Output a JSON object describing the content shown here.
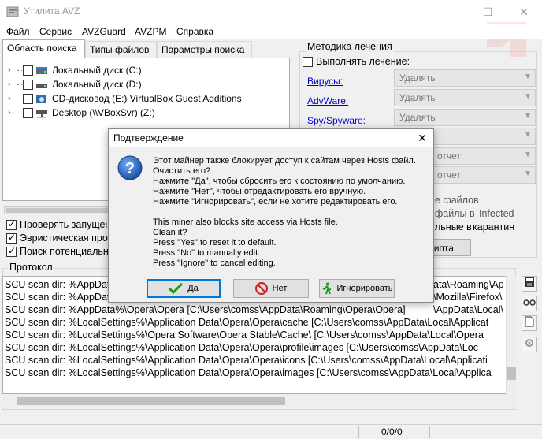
{
  "window": {
    "title": "Утилита AVZ",
    "minimize_glyph": "—",
    "maximize_glyph": "☐",
    "close_glyph": "✕",
    "icon": "avz-app-icon",
    "accent_color": "#e8403a"
  },
  "menu": [
    "Файл",
    "Сервис",
    "AVZGuard",
    "AVZPM",
    "Справка"
  ],
  "tabs": [
    "Область поиска",
    "Типы файлов",
    "Параметры поиска"
  ],
  "tree": {
    "chevron": "›",
    "items": [
      {
        "label": "Локальный диск (C:)",
        "icon": "local-disk-icon"
      },
      {
        "label": "Локальный диск (D:)",
        "icon": "local-disk-icon"
      },
      {
        "label": "CD-дисковод (E:) VirtualBox Guest Additions",
        "icon": "cd-drive-icon"
      },
      {
        "label": "Desktop (\\\\VBoxSvr) (Z:)",
        "icon": "network-drive-icon"
      }
    ]
  },
  "options": [
    {
      "label": "Проверять запущен",
      "checked": true
    },
    {
      "label": "Эвристическая про",
      "checked": true
    },
    {
      "label": "Поиск потенциальн",
      "checked": true
    }
  ],
  "treatment": {
    "group_title": "Методика лечения",
    "enable_label": "Выполнять лечение:",
    "links": [
      "Вирусы:",
      "AdvWare:",
      "Spy/Spyware:"
    ],
    "combos": [
      "Удалять",
      "Удалять",
      "Удалять",
      "",
      "отчет",
      "отчет"
    ],
    "partial_texts": [
      "е файлов",
      "файлы в",
      "Infected",
      "льные в",
      "карантин"
    ],
    "script_button": "рипта"
  },
  "protocol": {
    "title": "Протокол",
    "lines": [
      {
        "left": "SCU scan dir: %AppDat",
        "right": "ata\\Roaming\\Ap"
      },
      {
        "left": "SCU scan dir: %AppDat",
        "right": "\\Mozilla\\Firefox\\"
      },
      {
        "left": "SCU scan dir: %AppData%\\Opera\\Opera [C:\\Users\\comss\\AppData\\Roaming\\Opera\\Opera]",
        "right": "\\AppData\\Local\\"
      },
      {
        "left": "SCU scan dir: %LocalSettings%\\Application Data\\Opera\\Opera\\cache [C:\\Users\\comss\\AppData\\Local\\Applicat",
        "right": ""
      },
      {
        "left": "SCU scan dir: %LocalSettings%\\Opera Software\\Opera Stable\\Cache\\ [C:\\Users\\comss\\AppData\\Local\\Opera",
        "right": ""
      },
      {
        "left": "SCU scan dir: %LocalSettings%\\Application Data\\Opera\\Opera\\profile\\images [C:\\Users\\comss\\AppData\\Loc",
        "right": ""
      },
      {
        "left": "SCU scan dir: %LocalSettings%\\Application Data\\Opera\\Opera\\icons [C:\\Users\\comss\\AppData\\Local\\Applicati",
        "right": ""
      },
      {
        "left": "SCU scan dir: %LocalSettings%\\Application Data\\Opera\\Opera\\images [C:\\Users\\comss\\AppData\\Local\\Applica",
        "right": ""
      }
    ],
    "side_buttons": [
      "save-icon",
      "glasses-icon",
      "document-icon",
      "settings-icon"
    ]
  },
  "status": {
    "count": "0/0/0"
  },
  "dialog": {
    "title": "Подтверждение",
    "close_glyph": "✕",
    "icon": "question-icon",
    "message_ru": [
      "Этот майнер также блокирует доступ к сайтам через Hosts файл.",
      "Очистить его?",
      "Нажмите \"Да\", чтобы сбросить его к состоянию по умолчанию.",
      "Нажмите \"Нет\", чтобы отредактировать его вручную.",
      "Нажмите \"Игнорировать\", если не хотите редактировать его."
    ],
    "message_en": [
      "This miner also blocks site access via Hosts file.",
      "Clean it?",
      "Press \"Yes\" to reset it to default.",
      "Press \"No\" to manually edit.",
      "Press \"Ignore\" to cancel editing."
    ],
    "buttons": {
      "yes": "Да",
      "no": "Нет",
      "ignore": "Игнорировать"
    }
  }
}
